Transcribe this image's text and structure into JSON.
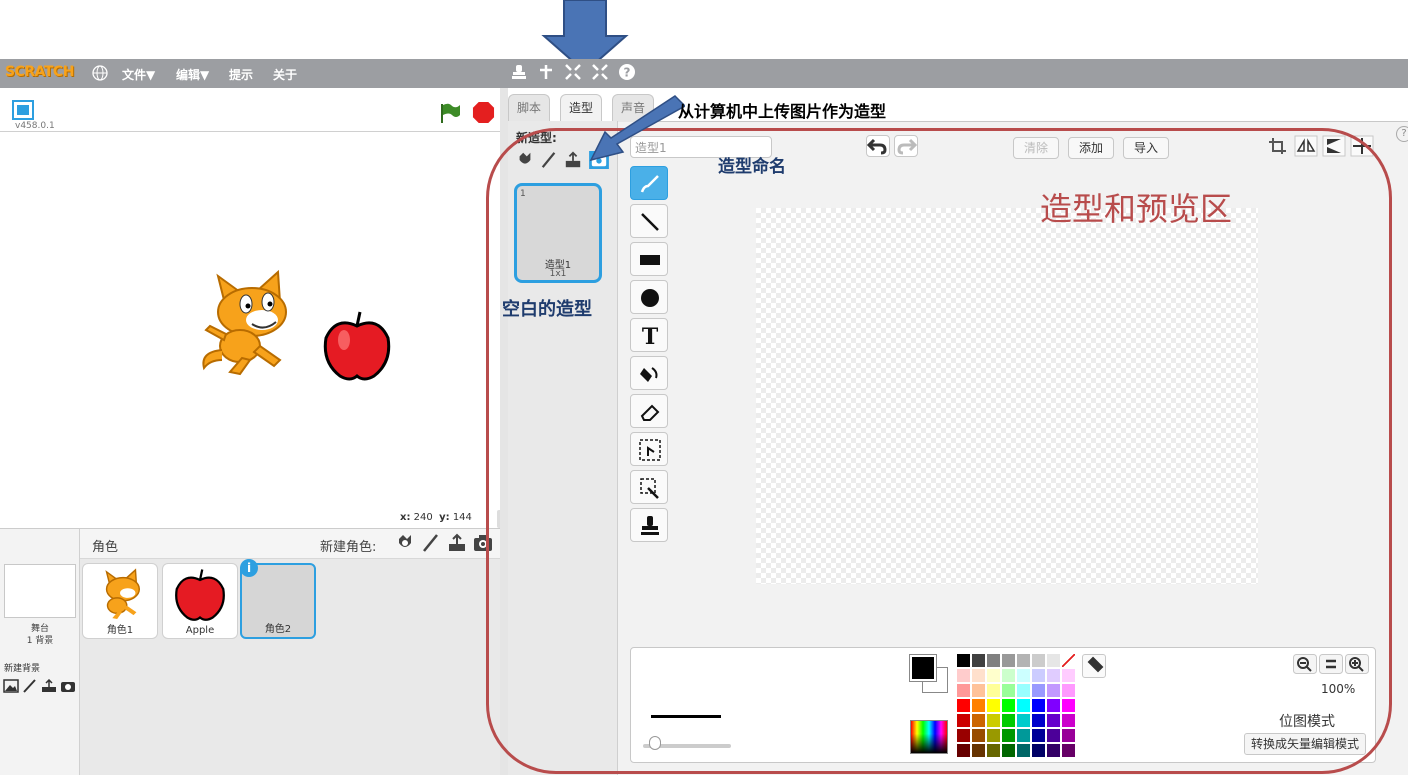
{
  "menubar": {
    "logo": "SCRATCH",
    "file": "文件▼",
    "edit": "编辑▼",
    "tips": "提示",
    "about": "关于"
  },
  "stage": {
    "version": "v458.0.1",
    "coords_x_label": "x:",
    "coords_x": "240",
    "coords_y_label": "y:",
    "coords_y": "144"
  },
  "sprites": {
    "title": "角色",
    "new_sprite_label": "新建角色:",
    "stage_label": "舞台",
    "stage_backdrops": "1 背景",
    "new_backdrop_label": "新建背景",
    "items": [
      {
        "label": "角色1"
      },
      {
        "label": "Apple"
      },
      {
        "label": "角色2"
      }
    ],
    "info_badge": "i"
  },
  "tabs": {
    "scripts": "脚本",
    "costumes": "造型",
    "sounds": "声音"
  },
  "costumes": {
    "new_costume_label": "新造型:",
    "tile_number": "1",
    "tile_name": "造型1",
    "tile_size": "1x1"
  },
  "editor": {
    "name_value": "造型1",
    "clear": "清除",
    "add": "添加",
    "import": "导入",
    "zoom_level": "100%",
    "mode": "位图模式",
    "convert": "转换成矢量编辑模式"
  },
  "annotations": {
    "upload_note": "从计算机中上传图片作为造型",
    "naming_note": "造型命名",
    "area_note": "造型和预览区",
    "blank_note": "空白的造型"
  },
  "colors": {
    "accent": "#2d9fe0",
    "menubar": "#9c9ea2",
    "annotation_red": "#b84c4c",
    "annotation_blue": "#1f3c6e"
  },
  "palette": [
    "#000000",
    "#404040",
    "#808080",
    "#999999",
    "#b3b3b3",
    "#cccccc",
    "#e6e6e6",
    "#ffffff",
    "#ffcccc",
    "#ffe0cc",
    "#ffffcc",
    "#ccffcc",
    "#ccffff",
    "#ccccff",
    "#e0ccff",
    "#ffccff",
    "#ff9999",
    "#ffc299",
    "#ffff99",
    "#99ff99",
    "#99ffff",
    "#9999ff",
    "#c299ff",
    "#ff99ff",
    "#ff0000",
    "#ff8000",
    "#ffff00",
    "#00ff00",
    "#00ffff",
    "#0000ff",
    "#8000ff",
    "#ff00ff",
    "#cc0000",
    "#cc6600",
    "#cccc00",
    "#00cc00",
    "#00cccc",
    "#0000cc",
    "#6600cc",
    "#cc00cc",
    "#990000",
    "#994c00",
    "#999900",
    "#009900",
    "#009999",
    "#000099",
    "#4c0099",
    "#990099",
    "#660000",
    "#663300",
    "#666600",
    "#006600",
    "#006666",
    "#000066",
    "#330066",
    "#660066"
  ]
}
